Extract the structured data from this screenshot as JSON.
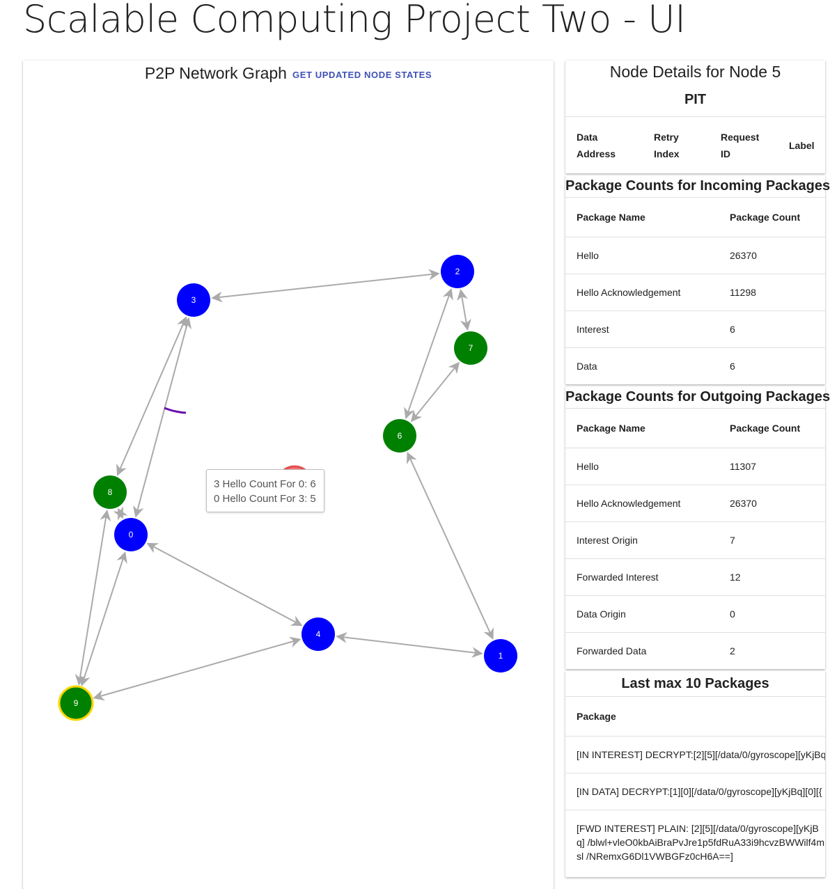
{
  "app": {
    "title": "Scalable Computing Project Two - UI"
  },
  "graph": {
    "title": "P2P Network Graph",
    "refresh_label": "GET UPDATED NODE STATES",
    "nodes": [
      {
        "id": "0",
        "color": "#0000ff",
        "selected": false
      },
      {
        "id": "1",
        "color": "#0000ff",
        "selected": false
      },
      {
        "id": "2",
        "color": "#0000ff",
        "selected": false
      },
      {
        "id": "3",
        "color": "#0000ff",
        "selected": false
      },
      {
        "id": "4",
        "color": "#0000ff",
        "selected": false
      },
      {
        "id": "5",
        "color": "#ff7070",
        "selected": true
      },
      {
        "id": "6",
        "color": "#008000",
        "selected": false
      },
      {
        "id": "7",
        "color": "#008000",
        "selected": false
      },
      {
        "id": "8",
        "color": "#008000",
        "selected": false
      },
      {
        "id": "9",
        "color": "#008000",
        "selected": false,
        "highlight": "#ffd700"
      }
    ],
    "edges": [
      [
        "3",
        "2"
      ],
      [
        "2",
        "7"
      ],
      [
        "2",
        "6"
      ],
      [
        "7",
        "6"
      ],
      [
        "6",
        "1"
      ],
      [
        "3",
        "8"
      ],
      [
        "3",
        "0"
      ],
      [
        "8",
        "0"
      ],
      [
        "0",
        "4"
      ],
      [
        "0",
        "9"
      ],
      [
        "8",
        "9"
      ],
      [
        "4",
        "9"
      ],
      [
        "4",
        "1"
      ]
    ],
    "tooltip": {
      "line1": "3 Hello Count For 0: 6",
      "line2": "0 Hello Count For 3: 5"
    }
  },
  "details": {
    "title": "Node Details for Node 5",
    "pit": {
      "title": "PIT",
      "columns": [
        {
          "line1": "Data",
          "line2": "Address"
        },
        {
          "line1": "Retry",
          "line2": "Index"
        },
        {
          "line1": "Request",
          "line2": "ID"
        },
        {
          "line1": "Label",
          "line2": ""
        }
      ]
    },
    "incoming": {
      "title": "Package Counts for Incoming Packages",
      "headers": [
        "Package Name",
        "Package Count"
      ],
      "rows": [
        [
          "Hello",
          "26370"
        ],
        [
          "Hello Acknowledgement",
          "11298"
        ],
        [
          "Interest",
          "6"
        ],
        [
          "Data",
          "6"
        ]
      ]
    },
    "outgoing": {
      "title": "Package Counts for Outgoing Packages",
      "headers": [
        "Package Name",
        "Package Count"
      ],
      "rows": [
        [
          "Hello",
          "11307"
        ],
        [
          "Hello Acknowledgement",
          "26370"
        ],
        [
          "Interest Origin",
          "7"
        ],
        [
          "Forwarded Interest",
          "12"
        ],
        [
          "Data Origin",
          "0"
        ],
        [
          "Forwarded Data",
          "2"
        ]
      ]
    },
    "last_packages": {
      "title": "Last max 10 Packages",
      "header": "Package",
      "rows": [
        "[IN INTEREST] DECRYPT:[2][5][/data/0/gyroscope][yKjBq",
        "[IN DATA] DECRYPT:[1][0][/data/0/gyroscope][yKjBq][0][{",
        "[FWD INTEREST] PLAIN: [2][5][/data/0/gyroscope][yKjBq] /blwl+vleO0kbAiBraPvJre1p5fdRuA33i9hcvzBWWilf4msl /NRemxG6Dl1VWBGFz0cH6A==]"
      ]
    }
  }
}
